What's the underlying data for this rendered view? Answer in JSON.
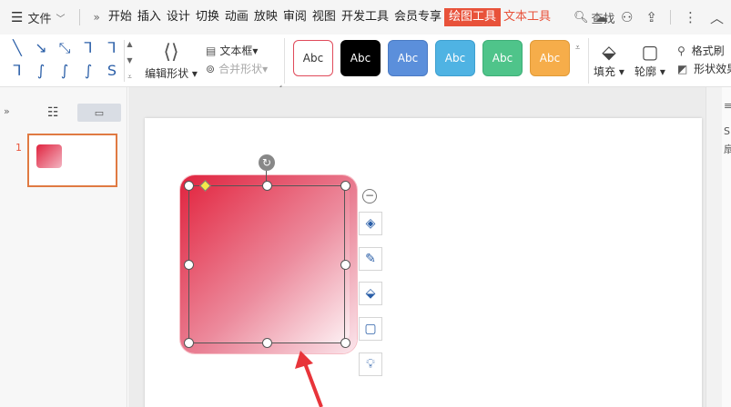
{
  "menubar": {
    "file_label": "文件",
    "tabs": [
      {
        "label": "开始"
      },
      {
        "label": "插入"
      },
      {
        "label": "设计"
      },
      {
        "label": "切换"
      },
      {
        "label": "动画"
      },
      {
        "label": "放映"
      },
      {
        "label": "审阅"
      },
      {
        "label": "视图"
      },
      {
        "label": "开发工具"
      },
      {
        "label": "会员专享"
      },
      {
        "label": "绘图工具"
      },
      {
        "label": "文本工具"
      }
    ],
    "active_tab": "绘图工具",
    "search_label": "查找"
  },
  "ribbon": {
    "edit_shape_label": "编辑形状",
    "textbox_label": "文本框",
    "merge_shape_label": "合并形状",
    "style_swatches": [
      {
        "label": "Abc",
        "bg": "#ffffff",
        "fg": "#333333",
        "border": "#e04a5a"
      },
      {
        "label": "Abc",
        "bg": "#000000",
        "fg": "#ffffff",
        "border": "#000000"
      },
      {
        "label": "Abc",
        "bg": "#5b8fdb",
        "fg": "#ffffff",
        "border": "#4a7ac4"
      },
      {
        "label": "Abc",
        "bg": "#4fb3e3",
        "fg": "#ffffff",
        "border": "#3d9fcf"
      },
      {
        "label": "Abc",
        "bg": "#4fc48a",
        "fg": "#ffffff",
        "border": "#3daf76"
      },
      {
        "label": "Abc",
        "bg": "#f6ad4a",
        "fg": "#ffffff",
        "border": "#e09a38"
      }
    ],
    "fill_label": "填充",
    "outline_label": "轮廓",
    "format_painter_label": "格式刷",
    "shape_effect_label": "形状效果"
  },
  "slides": {
    "current_number": "1"
  },
  "right_panel": {
    "label_top": "S",
    "label_mid": "扇"
  },
  "colors": {
    "accent": "#e8523a",
    "shape_gradient_start": "#e0243f",
    "shape_gradient_end": "#fbe6ec"
  }
}
